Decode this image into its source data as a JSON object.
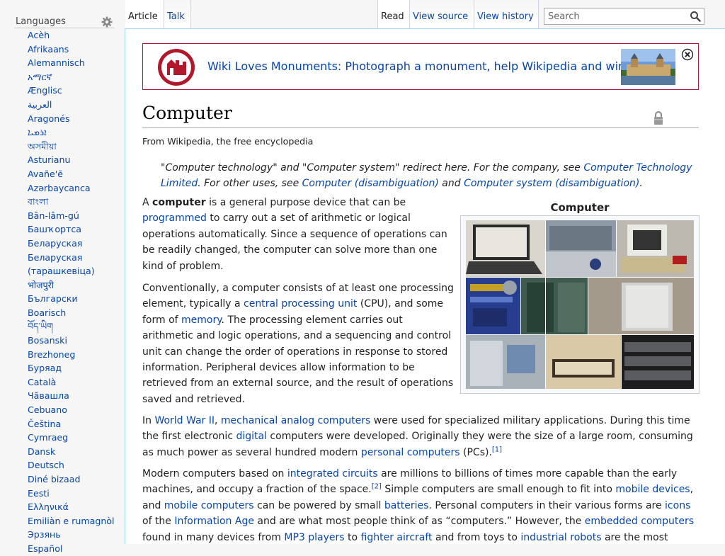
{
  "sidebar": {
    "languages_title": "Languages",
    "languages": [
      "Acèh",
      "Afrikaans",
      "Alemannisch",
      "አማርኛ",
      "Ænglisc",
      "العربية",
      "Aragonés",
      "ܐܪܡܝܐ",
      "অসমীয়া",
      "Asturianu",
      "Avañe'ẽ",
      "Azərbaycanca",
      "বাংলা",
      "Bân-lâm-gú",
      "Башҡортса",
      "Беларуская",
      "Беларуская (тарашкевіца)",
      "भोजपुरी",
      "Български",
      "Boarisch",
      "བོད་ཡིག",
      "Bosanski",
      "Brezhoneg",
      "Буряад",
      "Català",
      "Чӑвашла",
      "Cebuano",
      "Čeština",
      "Cymraeg",
      "Dansk",
      "Deutsch",
      "Diné bizaad",
      "Eesti",
      "Ελληνικά",
      "Emiliàn e rumagnòl",
      "Эрзянь",
      "Español"
    ]
  },
  "tabs": {
    "article": "Article",
    "talk": "Talk",
    "read": "Read",
    "view_source": "View source",
    "view_history": "View history"
  },
  "search": {
    "placeholder": "Search"
  },
  "banner": {
    "text": "Wiki Loves Monuments: Photograph a monument, help Wikipedia and win!"
  },
  "page": {
    "title": "Computer",
    "site_sub": "From Wikipedia, the free encyclopedia"
  },
  "hatnote": {
    "t1": "\"Computer technology\" and \"Computer system\" redirect here. For the company, see ",
    "l1": "Computer Technology Limited",
    "t2": ". For other uses, see ",
    "l2": "Computer (disambiguation)",
    "t3": " and ",
    "l3": "Computer system (disambiguation)",
    "t4": "."
  },
  "infobox": {
    "caption": "Computer"
  },
  "p1": {
    "t1": "A ",
    "b1": "computer",
    "t2": " is a general purpose device that can be ",
    "l1": "programmed",
    "t3": " to carry out a set of arithmetic or logical operations automatically. Since a sequence of operations can be readily changed, the computer can solve more than one kind of problem."
  },
  "p2": {
    "t1": "Conventionally, a computer consists of at least one processing element, typically a ",
    "l1": "central processing unit",
    "t2": " (CPU), and some form of ",
    "l2": "memory",
    "t3": ". The processing element carries out arithmetic and logic operations, and a sequencing and control unit can change the order of operations in response to stored information. Peripheral devices allow information to be retrieved from an external source, and the result of operations saved and retrieved."
  },
  "p3": {
    "t0": "In ",
    "l1": "World War II",
    "t1": ", ",
    "l2": "mechanical analog computers",
    "t2": " were used for specialized military applications. During this time the first electronic ",
    "l3": "digital",
    "t3": " computers were developed. Originally they were the size of a large room, consuming as much power as several hundred modern ",
    "l4": "personal computers",
    "t4": " (PCs).",
    "ref": "[1]"
  },
  "p4": {
    "t0": "Modern computers based on ",
    "l1": "integrated circuits",
    "t1": " are millions to billions of times more capable than the early machines, and occupy a fraction of the space.",
    "ref": "[2]",
    "t2": " Simple computers are small enough to fit into ",
    "l2": "mobile devices",
    "t3": ", and ",
    "l3": "mobile computers",
    "t4": " can be powered by small ",
    "l4": "batteries",
    "t5": ". Personal computers in their various forms are ",
    "l5": "icons",
    "t6": " of the ",
    "l6": "Information Age",
    "t7": " and are what most people think of as “computers.” However, the ",
    "l7": "embedded computers",
    "t8": " found in many devices from ",
    "l8": "MP3 players",
    "t9": " to ",
    "l9": "fighter aircraft",
    "t10": " and from toys to ",
    "l10": "industrial robots",
    "t11": " are the most"
  }
}
